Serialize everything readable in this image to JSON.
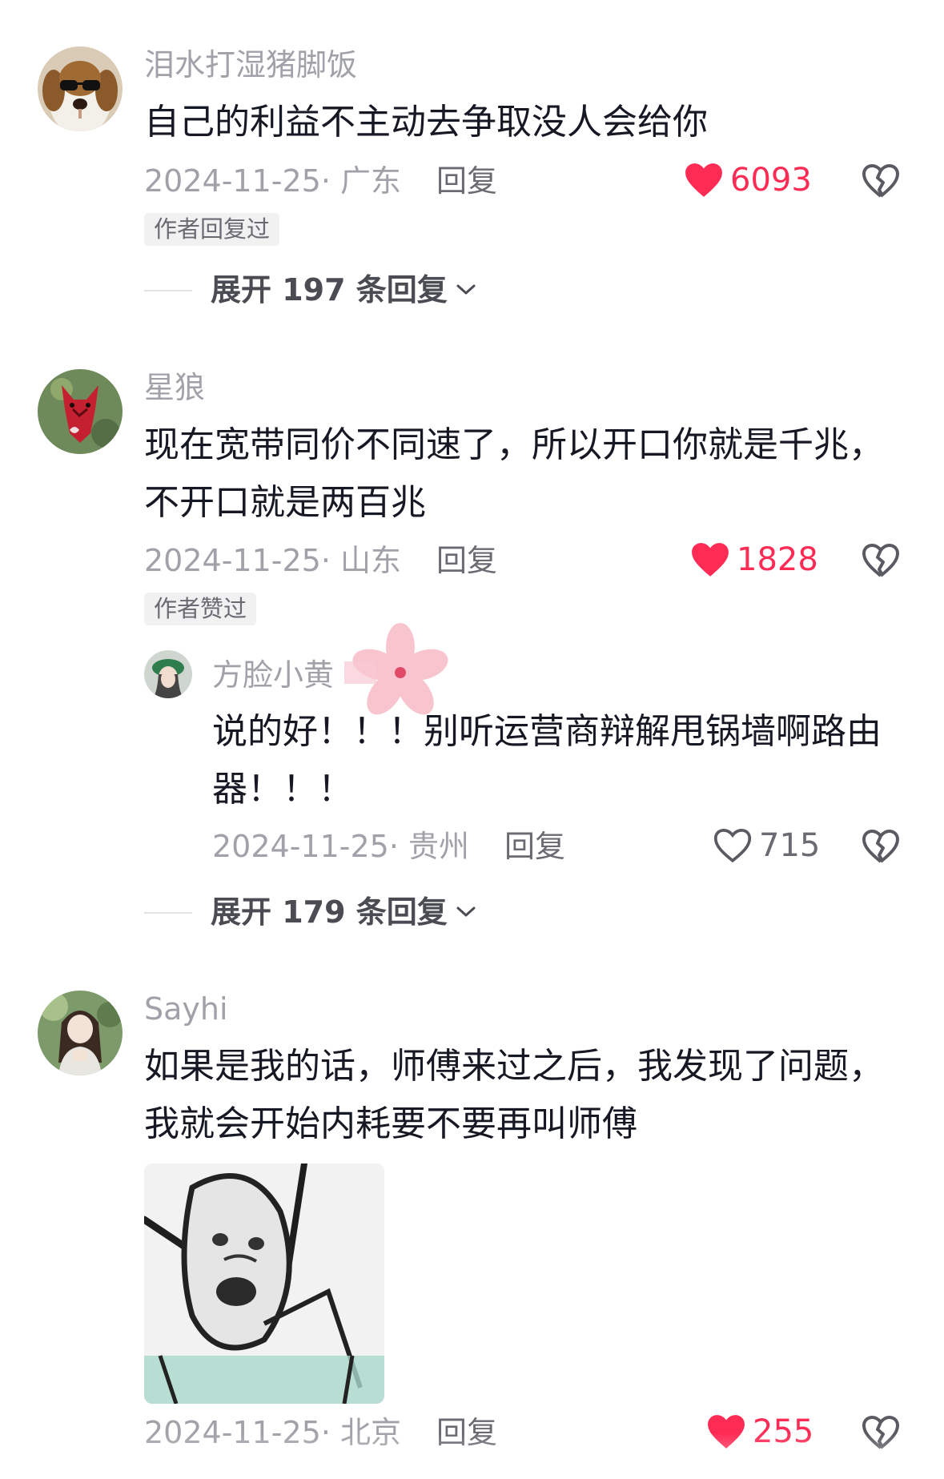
{
  "comments": [
    {
      "username": "泪水打湿猪脚饭",
      "lines": [
        "自己的利益不主动去争取没人会给你"
      ],
      "date": "2024-11-25· 广东",
      "reply_label": "回复",
      "likes": "6093",
      "liked": true,
      "badge": "作者回复过",
      "expand_label": "展开 197 条回复",
      "avatar_icon": "beagle-sunglasses-avatar"
    },
    {
      "username": "星狼",
      "lines": [
        "现在宽带同价不同速了，所以开口你就是千兆，",
        "不开口就是两百兆"
      ],
      "date": "2024-11-25· 山东",
      "reply_label": "回复",
      "likes": "1828",
      "liked": true,
      "badge": "作者赞过",
      "avatar_icon": "red-wolf-avatar",
      "reply": {
        "username": "方脸小黄",
        "lines": [
          "说的好！！！别听运营商辩解甩锅墙啊路由",
          "器！！！"
        ],
        "date": "2024-11-25· 贵州",
        "reply_label": "回复",
        "likes": "715",
        "liked": false,
        "avatar_icon": "girl-green-hat-avatar"
      },
      "expand_label": "展开 179 条回复"
    },
    {
      "username": "Sayhi",
      "lines": [
        "如果是我的话，师傅来过之后，我发现了问题，",
        "我就会开始内耗要不要再叫师傅"
      ],
      "date": "2024-11-25· 北京",
      "reply_label": "回复",
      "likes": "255",
      "liked": true,
      "avatar_icon": "anime-girl-avatar",
      "image_icon": "crying-sketch-meme"
    }
  ],
  "colors": {
    "like_red": "#fe2c55",
    "meta_gray": "#a1a2a9",
    "text_dark": "#161823"
  }
}
